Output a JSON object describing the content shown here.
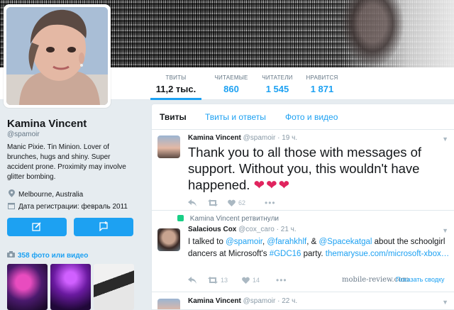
{
  "profile": {
    "name": "Kamina Vincent",
    "handle": "@spamoir",
    "bio": "Manic Pixie. Tin Minion. Lover of brunches, hugs and shiny. Super accident prone. Proximity may involve glitter bombing.",
    "location": "Melbourne, Australia",
    "joined": "Дата регистрации: февраль 2011",
    "photos_link": "358 фото или видео"
  },
  "stats": [
    {
      "label": "ТВИТЫ",
      "value": "11,2 тыс."
    },
    {
      "label": "ЧИТАЕМЫЕ",
      "value": "860"
    },
    {
      "label": "ЧИТАТЕЛИ",
      "value": "1 545"
    },
    {
      "label": "НРАВИТСЯ",
      "value": "1 871"
    }
  ],
  "tabs": [
    "Твиты",
    "Твиты и ответы",
    "Фото и видео"
  ],
  "tweets": [
    {
      "name": "Kamina Vincent",
      "handle": "@spamoir",
      "time": "· 19 ч.",
      "text": "Thank you to all those with messages of support. Without you, this wouldn't have happened.",
      "likes": "62"
    },
    {
      "retweet_label": "Kamina Vincent ретвитнули",
      "name": "Salacious Cox",
      "handle": "@cox_caro",
      "time": "· 21 ч.",
      "text_parts": {
        "p1": "I talked to ",
        "m1": "@spamoir",
        "p2": ", ",
        "m2": "@farahkhlf",
        "p3": ", & ",
        "m3": "@Spacekatgal",
        "p4": " about the schoolgirl dancers at Microsoft's ",
        "tag": "#GDC16",
        "p5": " party. ",
        "url": "themarysue.com/microsoft-xbox…"
      },
      "retweets": "13",
      "likes": "14"
    },
    {
      "name": "Kamina Vincent",
      "handle": "@spamoir",
      "time": "· 22 ч."
    }
  ],
  "watermark": "mobile-review.com",
  "show_summary": "Показать сводку"
}
